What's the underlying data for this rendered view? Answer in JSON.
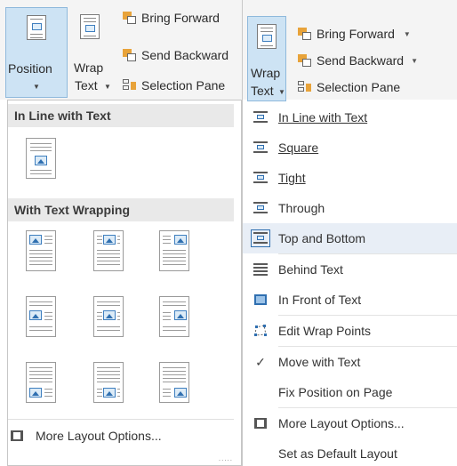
{
  "left_ribbon": {
    "position_label": "Position",
    "wrap_label": "Wrap",
    "text_label": "Text",
    "bring_forward": "Bring Forward",
    "send_backward": "Send Backward",
    "selection_pane": "Selection Pane"
  },
  "position_menu": {
    "inline_header": "In Line with Text",
    "wrapping_header": "With Text Wrapping",
    "more_layout": "More Layout Options...",
    "grip": "....."
  },
  "right_ribbon": {
    "wrap_label": "Wrap",
    "text_label": "Text",
    "bring_forward": "Bring Forward",
    "send_backward": "Send Backward",
    "selection_pane": "Selection Pane"
  },
  "wrap_menu": {
    "items": [
      {
        "label": "In Line with Text",
        "icon": "inline-wrap-icon"
      },
      {
        "label": "Square",
        "icon": "square-wrap-icon"
      },
      {
        "label": "Tight",
        "icon": "tight-wrap-icon"
      },
      {
        "label": "Through",
        "icon": "through-wrap-icon"
      },
      {
        "label": "Top and Bottom",
        "icon": "top-bottom-wrap-icon"
      },
      {
        "label": "Behind Text",
        "icon": "behind-text-icon"
      },
      {
        "label": "In Front of Text",
        "icon": "front-of-text-icon"
      },
      {
        "label": "Edit Wrap Points",
        "icon": "edit-wrap-points-icon"
      },
      {
        "label": "Move with Text",
        "icon": "checkmark-icon"
      },
      {
        "label": "Fix Position on Page",
        "icon": ""
      },
      {
        "label": "More Layout Options...",
        "icon": "layout-options-icon"
      },
      {
        "label": "Set as Default Layout",
        "icon": ""
      }
    ],
    "check": "✓"
  },
  "colors": {
    "accent": "#2f6fb0",
    "hover_bg": "#cde3f4",
    "header_bg": "#e9e9e9",
    "icon_orange": "#e8a33a"
  }
}
